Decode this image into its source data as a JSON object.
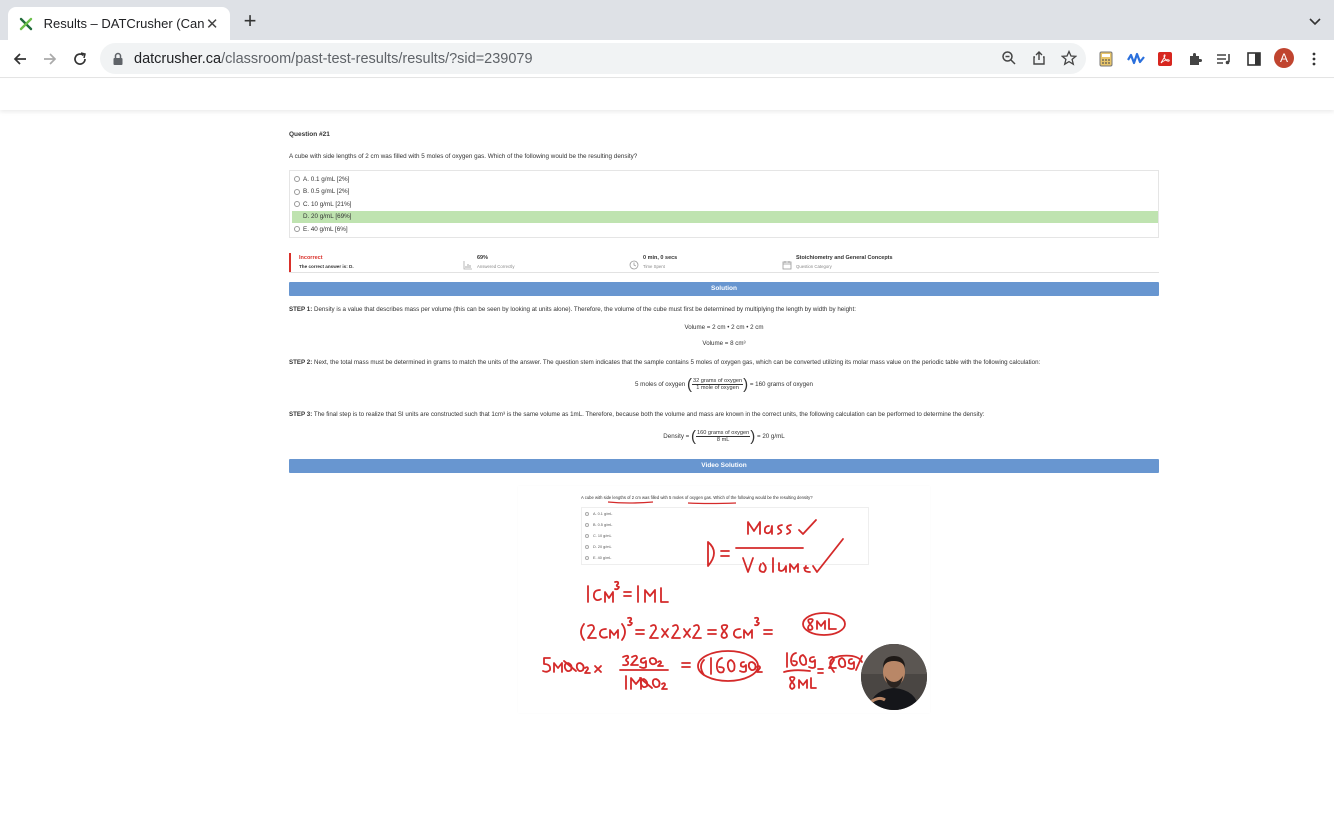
{
  "browser": {
    "tab_title": "Results – DATCrusher (Canadian",
    "url_domain": "datcrusher.ca",
    "url_path": "/classroom/past-test-results/results/?sid=239079",
    "profile_initial": "A",
    "accent": "#c0442f"
  },
  "question": {
    "number_label": "Question #21",
    "text": "A cube with side lengths of 2 cm was filled with 5 moles of oxygen gas. Which of the following would be the resulting density?",
    "choices": [
      {
        "label": "A. 0.1 g/mL [2%]",
        "correct": false
      },
      {
        "label": "B. 0.5 g/mL [2%]",
        "correct": false
      },
      {
        "label": "C. 10 g/mL [21%]",
        "correct": false
      },
      {
        "label": "D. 20 g/mL [69%]",
        "correct": true
      },
      {
        "label": "E. 40 g/mL [6%]",
        "correct": false
      }
    ]
  },
  "result": {
    "status": "Incorrect",
    "correct_answer": "The correct answer is: D.",
    "percent": "69%",
    "percent_label": "Answered Correctly",
    "time": "0 min, 0 secs",
    "time_label": "Time Spent",
    "category": "Stoichiometry and General Concepts",
    "category_label": "Question Category",
    "status_color": "#d9302a"
  },
  "solution": {
    "header": "Solution",
    "step1_label": "STEP 1:",
    "step1_text": " Density is a value that describes mass per volume (this can be seen by looking at units alone). Therefore, the volume of the cube must first be determined by multiplying the length by width by height:",
    "eq1": "Volume = 2 cm • 2 cm • 2 cm",
    "eq2": "Volume = 8 cm³",
    "step2_label": "STEP 2:",
    "step2_text": " Next, the total mass must be determined in grams to match the units of the answer. The question stem indicates that the sample contains 5 moles of oxygen gas, which can be converted utilizing its molar mass value on the periodic table with the following calculation:",
    "eq3_left": "5 moles of oxygen",
    "eq3_num": "32 grams of oxygen",
    "eq3_den": "1 mole of oxygen",
    "eq3_right": "= 160 grams of oxygen",
    "step3_label": "STEP 3:",
    "step3_text": " The final step is to realize that SI units are constructed such that 1cm³ is the same volume as 1mL. Therefore, because both the volume and mass are known in the correct units, the following calculation can be performed to determine the density:",
    "eq4_left": "Density =",
    "eq4_num": "160 grams of oxygen",
    "eq4_den": "8 mL",
    "eq4_right": "= 20 g/mL",
    "bar_color": "#6896d0"
  },
  "video": {
    "header": "Video Solution",
    "question_text": "A cube with side lengths of 2 cm was filled with 5 moles of oxygen gas. Which of the following would be the resulting density?",
    "choices": [
      "A. 0.1 g/mL",
      "B. 0.5 g/mL",
      "C. 10 g/mL",
      "D. 20 g/mL",
      "E. 40 g/mL"
    ],
    "ink_color": "#d42a2a"
  }
}
